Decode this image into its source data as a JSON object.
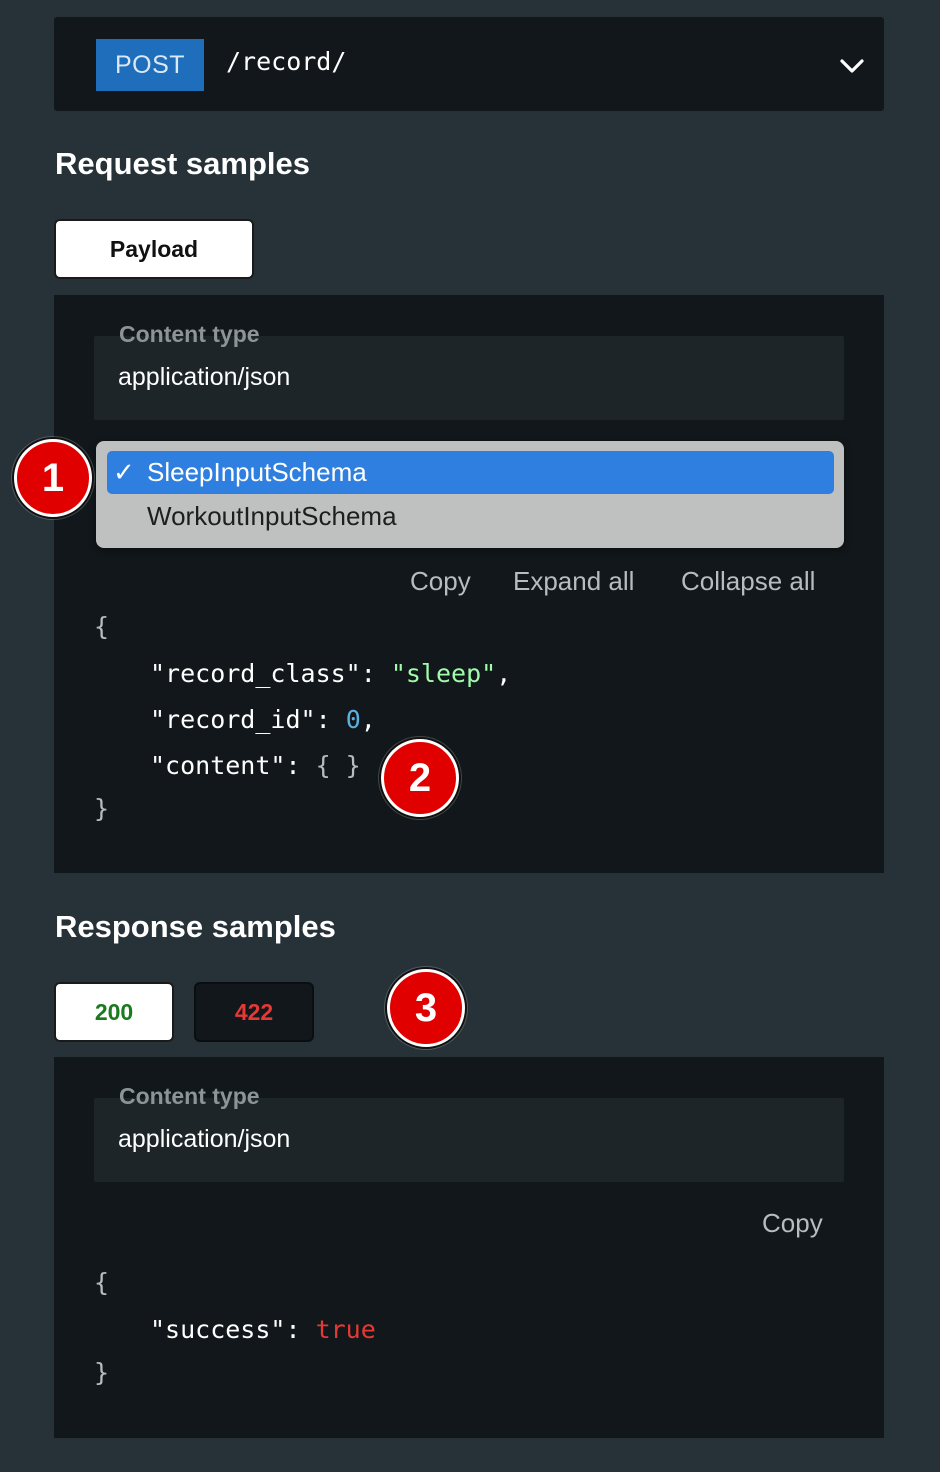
{
  "operation": {
    "method": "POST",
    "path": "/record/"
  },
  "request": {
    "title": "Request samples",
    "tab": "Payload",
    "content_type_label": "Content type",
    "content_type_value": "application/json",
    "schema_options": [
      {
        "label": "SleepInputSchema",
        "selected": true,
        "check": "✓"
      },
      {
        "label": "WorkoutInputSchema",
        "selected": false
      }
    ],
    "actions": {
      "copy": "Copy",
      "expand": "Expand all",
      "collapse": "Collapse all"
    },
    "code": {
      "open": "{",
      "close": "}",
      "lines": [
        {
          "key": "\"record_class\"",
          "colon": ": ",
          "value": "\"sleep\"",
          "tail": ","
        },
        {
          "key": "\"record_id\"",
          "colon": ": ",
          "value": "0",
          "tail": ","
        },
        {
          "key": "\"content\"",
          "colon": ": ",
          "value": "{ }",
          "tail": ""
        }
      ]
    }
  },
  "response": {
    "title": "Response samples",
    "tabs": [
      {
        "label": "200",
        "color": "#1b7a1f"
      },
      {
        "label": "422",
        "color": "#e53935"
      }
    ],
    "content_type_label": "Content type",
    "content_type_value": "application/json",
    "actions": {
      "copy": "Copy"
    },
    "code": {
      "open": "{",
      "close": "}",
      "lines": [
        {
          "key": "\"success\"",
          "colon": ": ",
          "value": "true"
        }
      ]
    }
  },
  "badges": [
    "1",
    "2",
    "3"
  ],
  "colors": {
    "background": "#263238",
    "panel": "#11171a",
    "method": "#1f6ebc",
    "selection": "#2f7fe0",
    "badge": "#e00000"
  }
}
